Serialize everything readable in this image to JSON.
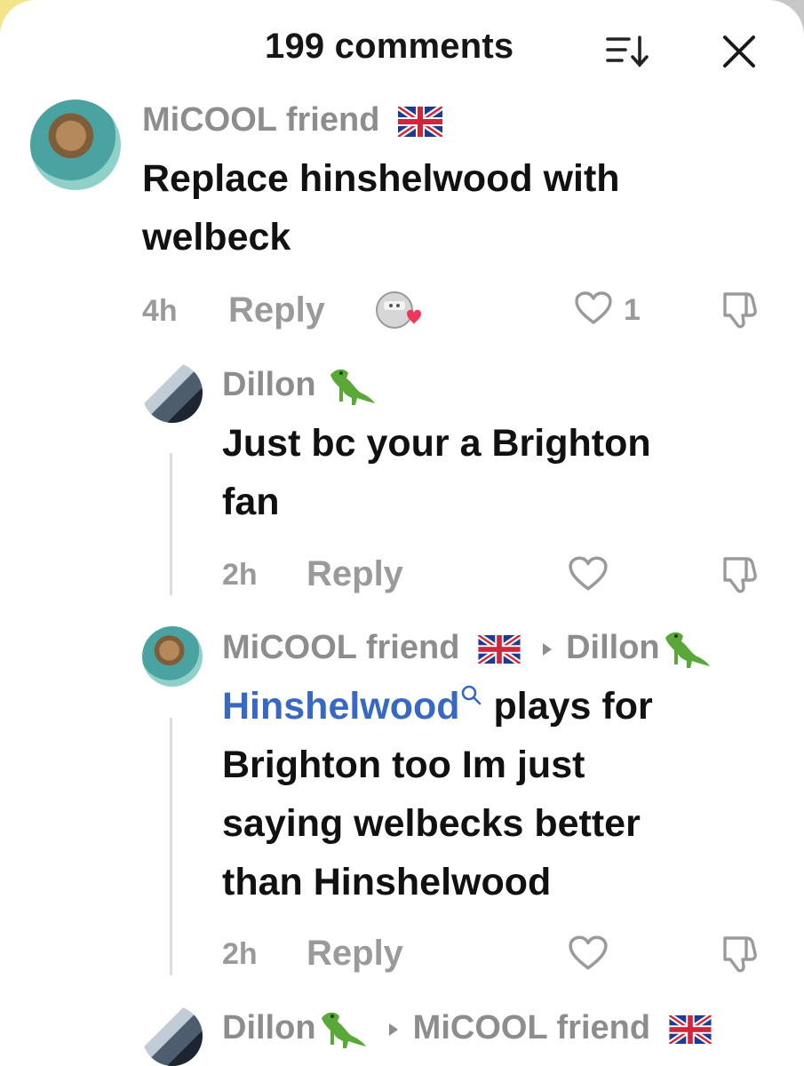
{
  "header": {
    "title": "199 comments"
  },
  "icons": {
    "sort": "sort-icon",
    "close": "close-icon",
    "like": "heart-icon",
    "dislike": "thumbs-down-icon",
    "flag": "uk-flag-icon",
    "dino": "t-rex-emoji-icon",
    "search": "search-icon",
    "reply_arrow": "caret-right-icon"
  },
  "colors": {
    "username": "#8d8d8d",
    "mention": "#3768c4",
    "meta": "#9a9a9a"
  },
  "comments": [
    {
      "username": "MiCOOL friend",
      "text_line1": "Replace hinshelwood with",
      "text_line2": "welbeck",
      "time": "4h",
      "reply": "Reply",
      "likes": "1"
    },
    {
      "username": "Dillon",
      "text_line1": "Just bc your a Brighton",
      "text_line2": "fan",
      "time": "2h",
      "reply": "Reply"
    },
    {
      "username": "MiCOOL friend",
      "reply_to": "Dillon",
      "mention": "Hinshelwood",
      "text_line1_rest": "plays for",
      "text_line2": "Brighton too Im just",
      "text_line3": "saying welbecks better",
      "text_line4": "than Hinshelwood",
      "time": "2h",
      "reply": "Reply"
    },
    {
      "username": "Dillon",
      "reply_to": "MiCOOL friend"
    }
  ]
}
